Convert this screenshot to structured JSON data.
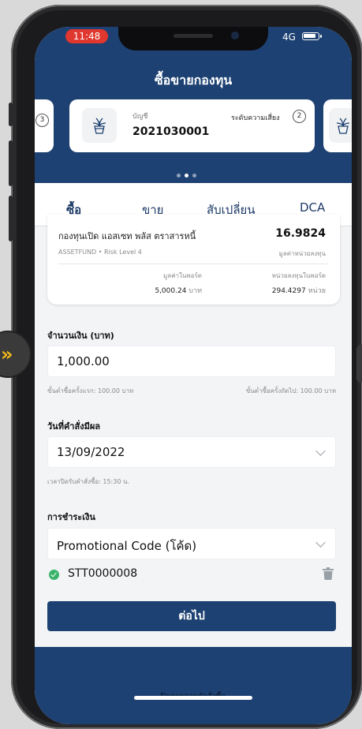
{
  "status": {
    "time": "11:48",
    "network": "4G"
  },
  "header": {
    "title": "ซื้อขายกองทุน"
  },
  "account_card": {
    "account_label": "บัญชี",
    "account_number": "2021030001",
    "risk_label": "ระดับความเสี่ยง",
    "risk_level": "2",
    "prev_card_number": "3",
    "carousel_active_index": 1,
    "carousel_count": 3
  },
  "tabs": [
    {
      "label": "ซื้อ",
      "active": true
    },
    {
      "label": "ขาย",
      "active": false
    },
    {
      "label": "สับเปลี่ยน",
      "active": false
    },
    {
      "label": "DCA",
      "active": false
    }
  ],
  "fund": {
    "name": "กองทุนเปิด แอสเซท พลัส ตราสารหนี้",
    "nav": "16.9824",
    "sub": "ASSETFUND • Risk Level 4",
    "nav_label": "มูลค่าหน่วยลงทุน",
    "port_value_label": "มูลค่าในพอร์ต",
    "port_value": "5,000.24",
    "port_value_unit": "บาท",
    "port_units_label": "หน่วยลงทุนในพอร์ต",
    "port_units": "294.4297",
    "port_units_unit": "หน่วย"
  },
  "amount": {
    "label": "จำนวนเงิน (บาท)",
    "value": "1,000.00",
    "min_first": "ขั้นต่ำซื้อครั้งแรก: 100.00 บาท",
    "min_next": "ขั้นต่ำซื้อครั้งถัดไป: 100.00 บาท"
  },
  "effective_date": {
    "label": "วันที่คำสั่งมีผล",
    "value": "13/09/2022",
    "cutoff": "เวลาปิดรับคำสั่งซื้อ: 15:30 น."
  },
  "payment": {
    "label": "การชำระเงิน",
    "method": "Promotional Code (โค้ด)",
    "code": "STT0000008"
  },
  "next_button": "ต่อไป",
  "bottom_text": "ปิดรายการคำสั่งซื้อ",
  "colors": {
    "brand_navy": "#1d4172",
    "success_green": "#3ab36a",
    "badge_yellow": "#f2b71b"
  }
}
